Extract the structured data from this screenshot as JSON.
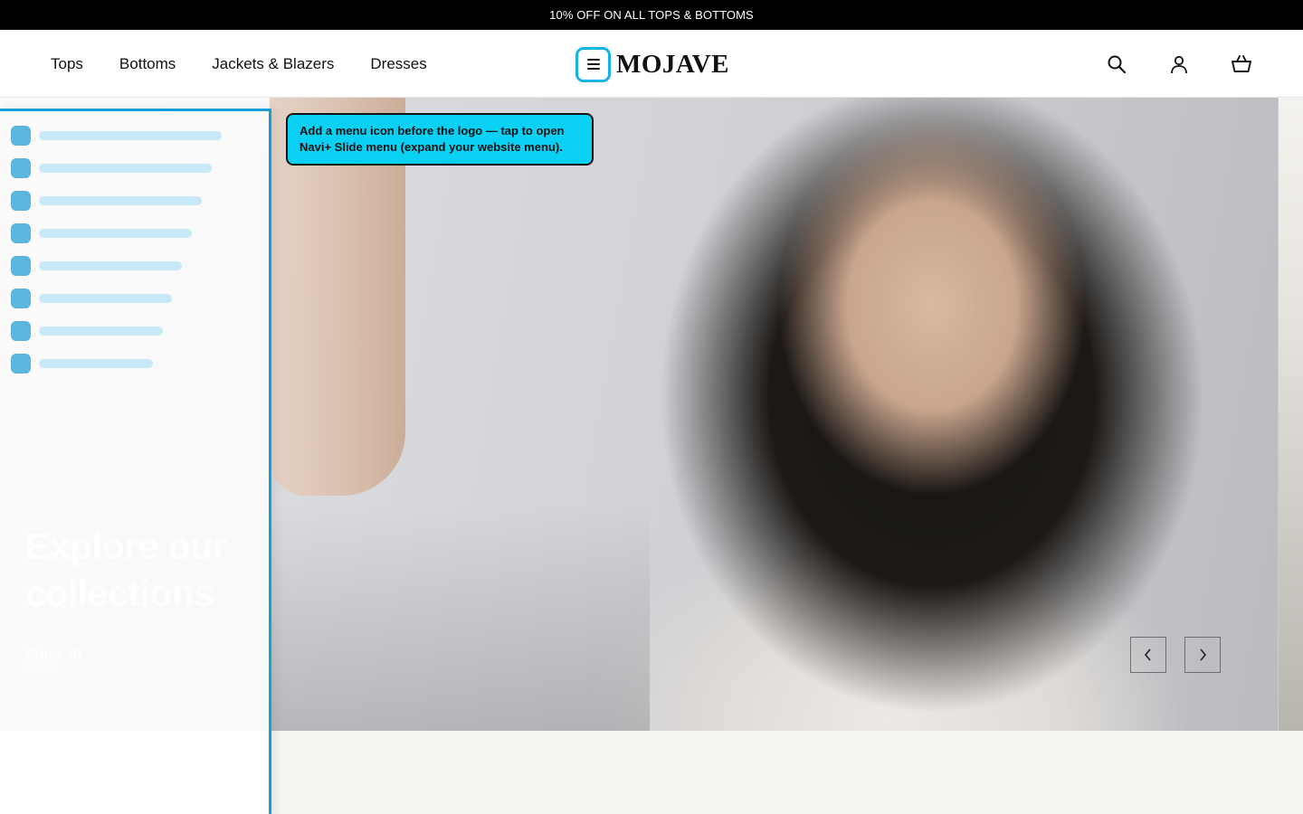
{
  "announcement": {
    "text": "10% OFF ON ALL TOPS & BOTTOMS"
  },
  "nav": {
    "items": [
      "Tops",
      "Bottoms",
      "Jackets & Blazers",
      "Dresses"
    ]
  },
  "logo": {
    "text": "MOJAVE"
  },
  "header_icons": [
    "search-icon",
    "account-icon",
    "cart-icon"
  ],
  "tooltip": {
    "text": "Add a menu icon before the logo — tap to open Navi+ Slide menu (expand your website menu)."
  },
  "hero": {
    "title": "Explore our collections",
    "cta": "Shop all"
  },
  "colors": {
    "accent": "#12b3e6",
    "tooltip_bg": "#0ad0f3",
    "announcement_bg": "#000000"
  }
}
